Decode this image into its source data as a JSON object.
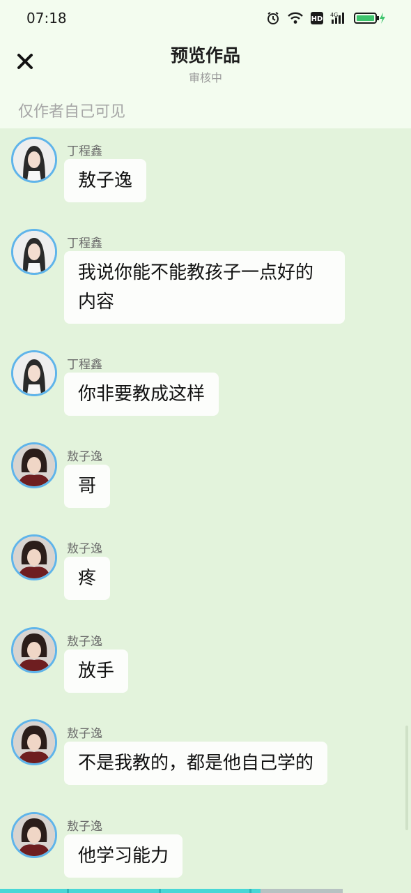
{
  "status_bar": {
    "time": "07:18"
  },
  "header": {
    "title": "预览作品",
    "subtitle": "审核中",
    "visibility": "仅作者自己可见"
  },
  "messages": [
    {
      "sender": "丁程鑫",
      "text": "敖子逸",
      "avatar": "dcx"
    },
    {
      "sender": "丁程鑫",
      "text": "我说你能不能教孩子一点好的内容",
      "avatar": "dcx"
    },
    {
      "sender": "丁程鑫",
      "text": "你非要教成这样",
      "avatar": "dcx"
    },
    {
      "sender": "敖子逸",
      "text": "哥",
      "avatar": "azy"
    },
    {
      "sender": "敖子逸",
      "text": "疼",
      "avatar": "azy"
    },
    {
      "sender": "敖子逸",
      "text": "放手",
      "avatar": "azy"
    },
    {
      "sender": "敖子逸",
      "text": "不是我教的，都是他自己学的",
      "avatar": "azy"
    },
    {
      "sender": "敖子逸",
      "text": "他学习能力",
      "avatar": "azy"
    }
  ],
  "colors": {
    "background": "#e3f3dc",
    "header_bg": "#f3fcef",
    "avatar_ring": "#5fb4ea",
    "bubble": "#fcfdfb",
    "progress": "#49d7d6",
    "battery": "#3ec46d"
  },
  "progress": {
    "fraction": 0.76
  }
}
